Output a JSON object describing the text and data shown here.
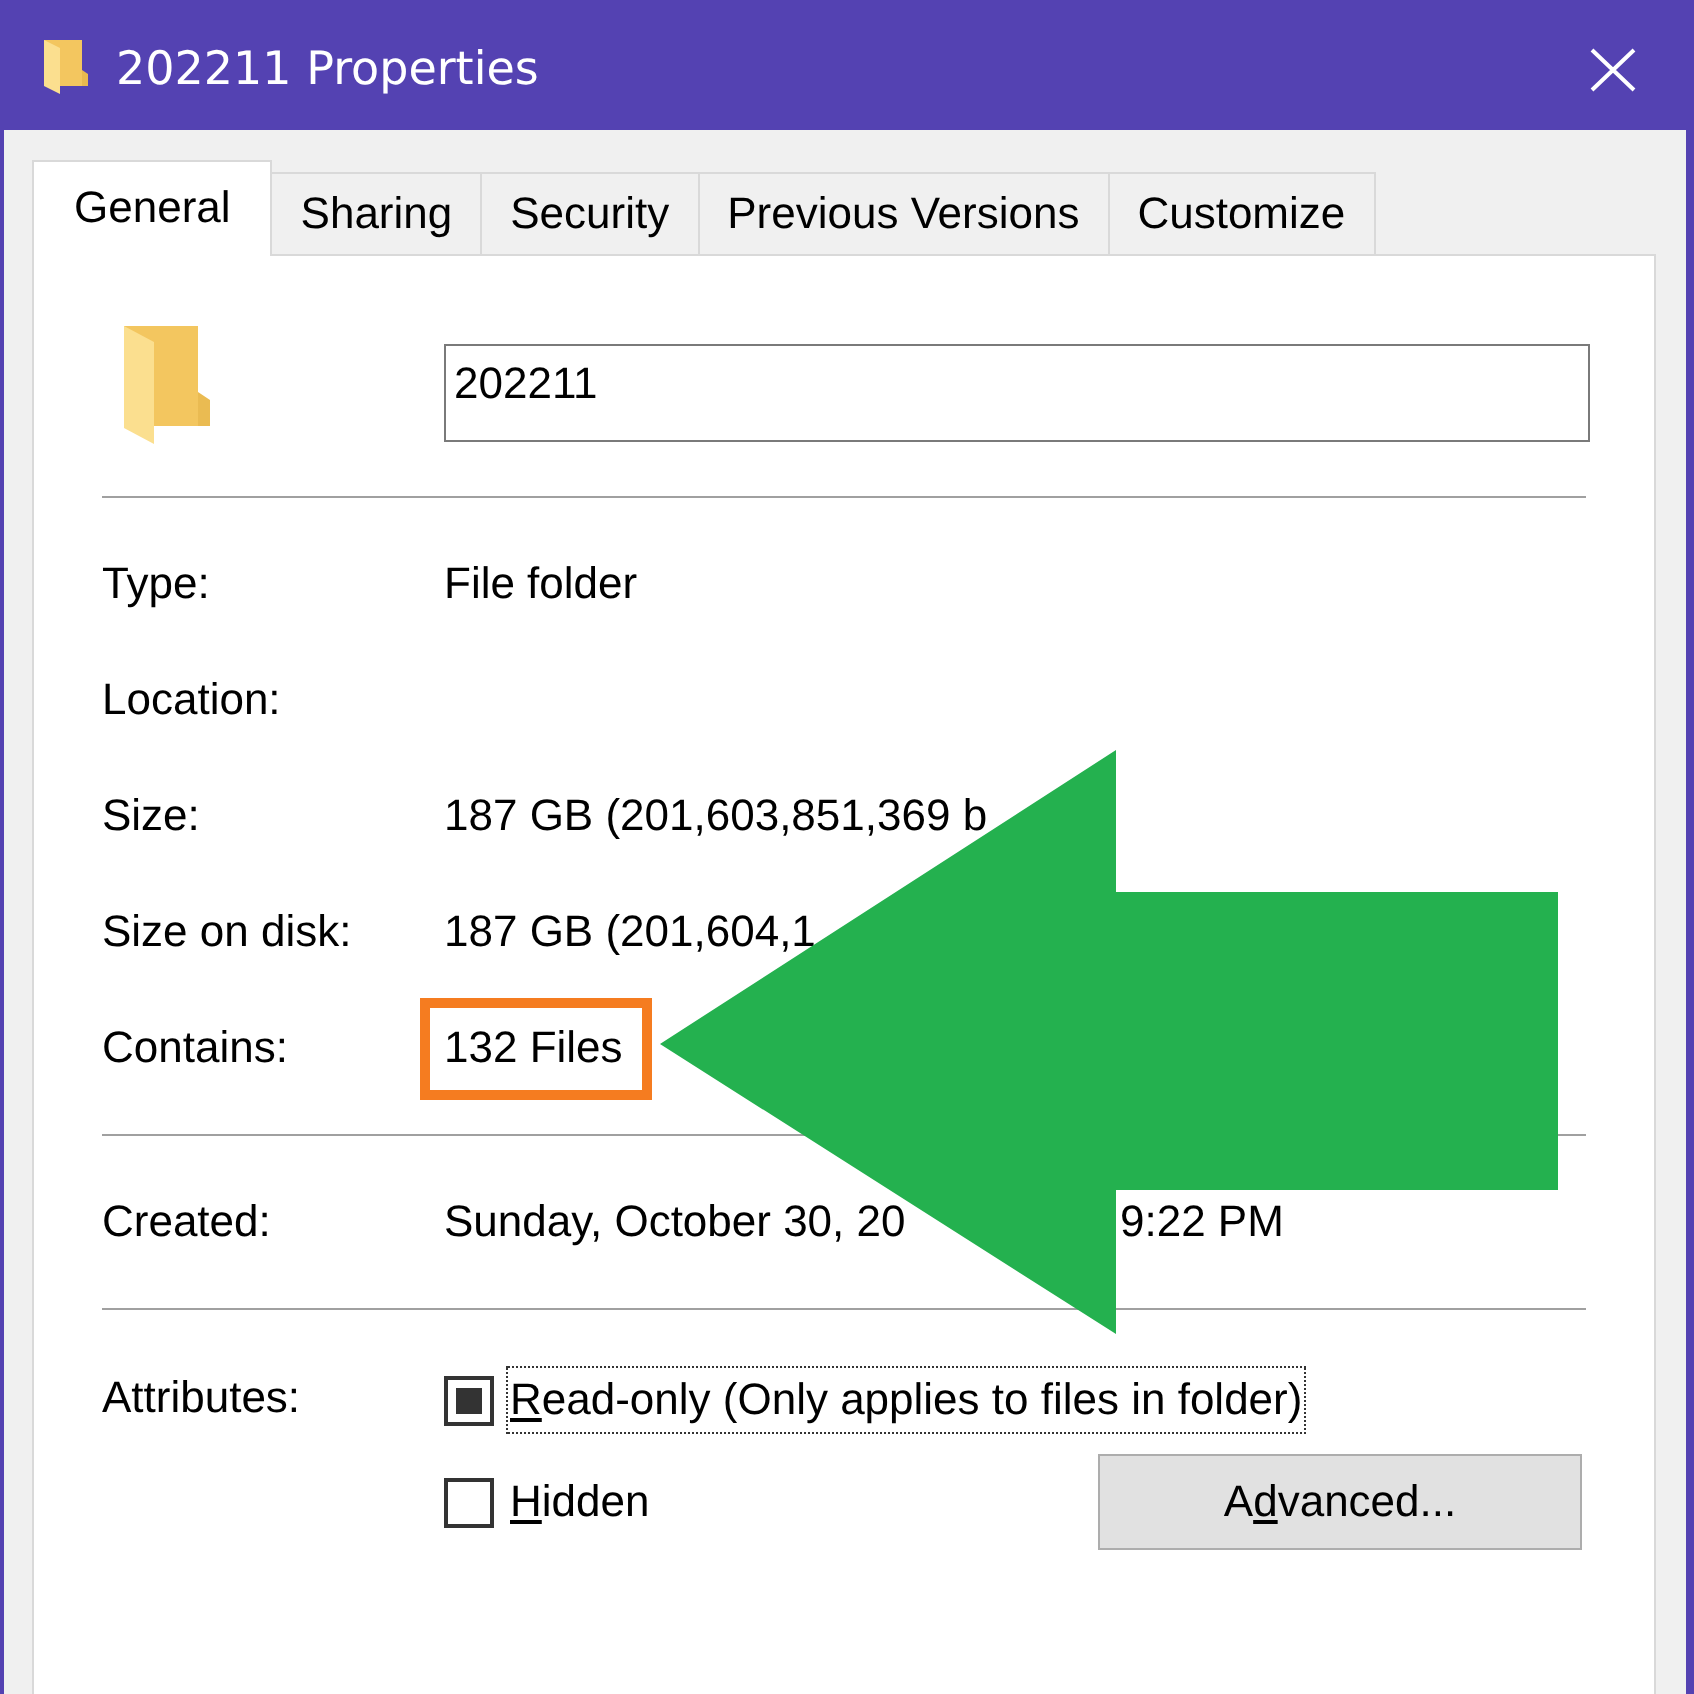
{
  "window": {
    "title": "202211 Properties"
  },
  "tabs": [
    {
      "label": "General",
      "selected": true
    },
    {
      "label": "Sharing",
      "selected": false
    },
    {
      "label": "Security",
      "selected": false
    },
    {
      "label": "Previous Versions",
      "selected": false
    },
    {
      "label": "Customize",
      "selected": false
    }
  ],
  "name_field": {
    "value": "202211"
  },
  "details": [
    {
      "label": "Type:",
      "value": "File folder",
      "highlighted": false
    },
    {
      "label": "Location:",
      "highlighted": false
    },
    {
      "label": "Size:",
      "value": "187 GB (201,603,851,369 b",
      "highlighted": false
    },
    {
      "label": "Size on disk:",
      "value": "187 GB (201,604,1",
      "highlighted": false
    },
    {
      "label": "Contains:",
      "value": "132 Files",
      "highlighted": true
    }
  ],
  "created": {
    "label": "Created:",
    "date": "Sunday, October 30, 20",
    "time": "9:22 PM"
  },
  "attributes": {
    "label": "Attributes:",
    "checkboxes": [
      {
        "label_parts": [
          {
            "text": "R",
            "underline": true
          },
          {
            "text": "ead-only (Only applies to files in folder)",
            "underline": false
          }
        ],
        "checked": false,
        "indeterminate": true,
        "focused": true
      },
      {
        "label_parts": [
          {
            "text": "H",
            "underline": true
          },
          {
            "text": "idden",
            "underline": false
          }
        ],
        "checked": false,
        "indeterminate": false,
        "focused": false
      }
    ]
  },
  "advanced_button": {
    "label_parts": [
      {
        "text": "A",
        "underline": false
      },
      {
        "text": "d",
        "underline": true
      },
      {
        "text": "vanced...",
        "underline": false
      }
    ]
  }
}
